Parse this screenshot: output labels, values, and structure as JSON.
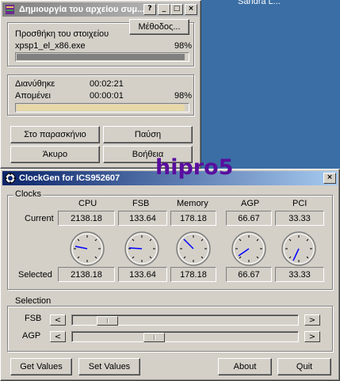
{
  "desktop": {
    "label": "Sandra L..."
  },
  "install_window": {
    "title": "Δημιουργία του αρχείου συμ...",
    "method_button": "Μέθοδος...",
    "add_item_label": "Προσθήκη του στοιχείου",
    "file_name": "xpsp1_el_x86.exe",
    "file_percent": "98%",
    "file_progress": 0.98,
    "elapsed_label": "Διανύθηκε",
    "elapsed_time": "00:02:21",
    "remaining_label": "Απομένει",
    "remaining_time": "00:00:01",
    "overall_percent": "98%",
    "overall_progress": 0.98,
    "buttons": {
      "background": "Στο παρασκήνιο",
      "pause": "Παύση",
      "cancel": "Άκυρο",
      "help": "Βοήθεια"
    }
  },
  "clockgen": {
    "title": "ClockGen for ICS952607",
    "clocks_group": "Clocks",
    "columns": [
      "CPU",
      "FSB",
      "Memory",
      "AGP",
      "PCI"
    ],
    "current_label": "Current",
    "selected_label": "Selected",
    "current": [
      "2138.18",
      "133.64",
      "178.18",
      "66.67",
      "33.33"
    ],
    "selected": [
      "2138.18",
      "133.64",
      "178.18",
      "66.67",
      "33.33"
    ],
    "selection_group": "Selection",
    "fsb_label": "FSB",
    "agp_label": "AGP",
    "left_arrow": "<",
    "right_arrow": ">",
    "fsb_slider_level": 0.12,
    "agp_slider_level": 0.35,
    "buttons": {
      "get_values": "Get Values",
      "set_values": "Set Values",
      "about": "About",
      "quit": "Quit"
    }
  },
  "watermark": "hipro5",
  "colors": {
    "desktop": "#3a6ea5",
    "face": "#d4d0c8",
    "progress_file": "#808080",
    "progress_overall": "#e8d8a8",
    "watermark": "#5a0d9e",
    "clock_hand": "#0000ff"
  }
}
